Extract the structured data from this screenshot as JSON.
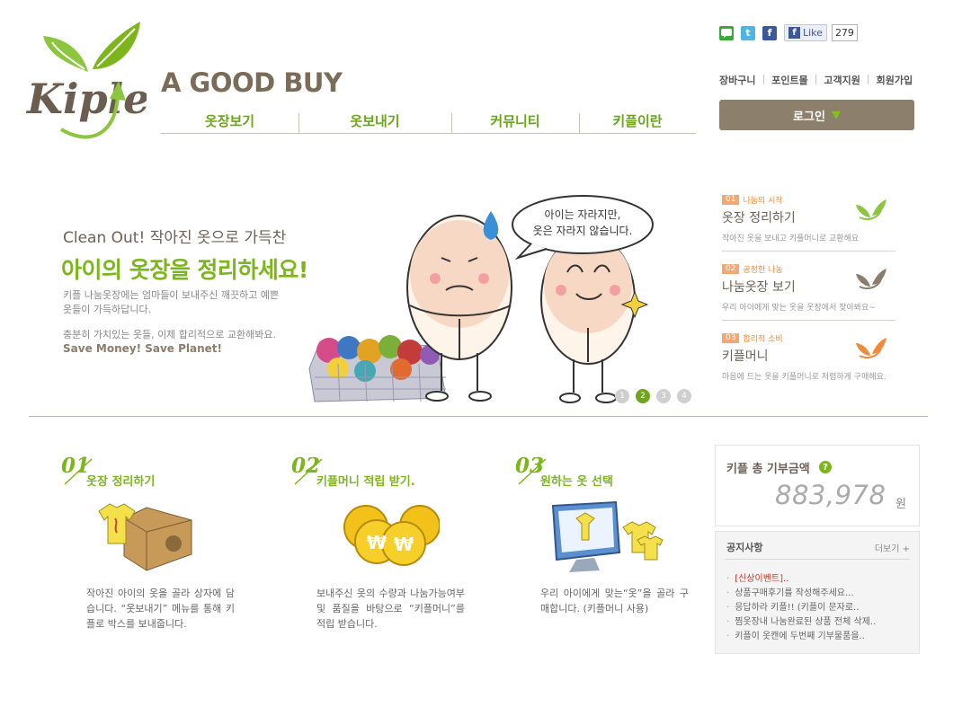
{
  "header": {
    "brand_text": "A GOOD BUY",
    "logo_text": "Kiple",
    "nav": [
      {
        "label": "옷장보기"
      },
      {
        "label": "옷보내기"
      },
      {
        "label": "커뮤니티"
      },
      {
        "label": "키플이란"
      }
    ],
    "social": {
      "like_label": "Like",
      "like_count": "279",
      "icons": [
        "me2day-icon",
        "twitter-icon",
        "facebook-icon"
      ]
    },
    "util_links": [
      "장바구니",
      "포인트몰",
      "고객지원",
      "회원가입"
    ],
    "login_label": "로그인"
  },
  "hero": {
    "subtitle": "Clean Out! 작아진 옷으로 가득찬",
    "title": "아이의 옷장을 정리하세요!",
    "desc1": "키플 나눔옷장에는 엄마들이 보내주신 깨끗하고 예쁜 옷들이 가득하답니다.",
    "desc2": "충분히 가치있는 옷들, 이제 합리적으로 교환해봐요.",
    "save_line": "Save Money! Save Planet!",
    "bubble_line1": "아이는 자라지만,",
    "bubble_line2": "옷은 자라지 않습니다.",
    "slides": [
      "1",
      "2",
      "3",
      "4"
    ],
    "active_slide": 2
  },
  "side_steps": [
    {
      "num": "01",
      "tag": "나눔의 시작",
      "title": "옷장 정리하기",
      "desc": "작아진 옷을 보내고 키플머니로 교환해요"
    },
    {
      "num": "02",
      "tag": "공정한 나눔",
      "title": "나눔옷장 보기",
      "desc": "우리 아이에게 맞는 옷을 옷장에서 찾아봐요~"
    },
    {
      "num": "03",
      "tag": "합리적 소비",
      "title": "키플머니",
      "desc": "마음에 드는 옷을 키플머니로 저렴하게 구매해요."
    }
  ],
  "steps": [
    {
      "num": "01",
      "title": "옷장 정리하기",
      "desc": "작아진 아이의 옷을 골라 상자에 담습니다. “옷보내기” 메뉴를 통해 키플로 박스를 보내줍니다."
    },
    {
      "num": "02",
      "title": "키플머니 적립 받기.",
      "desc": "보내주신 옷의 수량과 나눔가능여부 및 품질을 바탕으로 “키플머니”를 적립 받습니다."
    },
    {
      "num": "03",
      "title": "원하는 옷 선택",
      "desc": "우리 아이에게 맞는“옷”을 골라 구매합니다. (키플머니 사용)"
    }
  ],
  "donation": {
    "label": "키플 총 기부금액",
    "help": "?",
    "amount": "883,978",
    "unit": "원"
  },
  "notice": {
    "title": "공지사항",
    "more": "더보기 +",
    "items": [
      "[신상이벤트]..",
      "상품구매후기를 작성해주세요...",
      "응답하라 키플!! (키플이 문자로..",
      "찜옷장내 나눔완료된 상품 전체 삭제..",
      "키플이 옷캔에 두번째 기부물품을.."
    ]
  },
  "colors": {
    "green": "#7cb51c",
    "brown": "#8c7f6c",
    "orange": "#f08a3c"
  }
}
